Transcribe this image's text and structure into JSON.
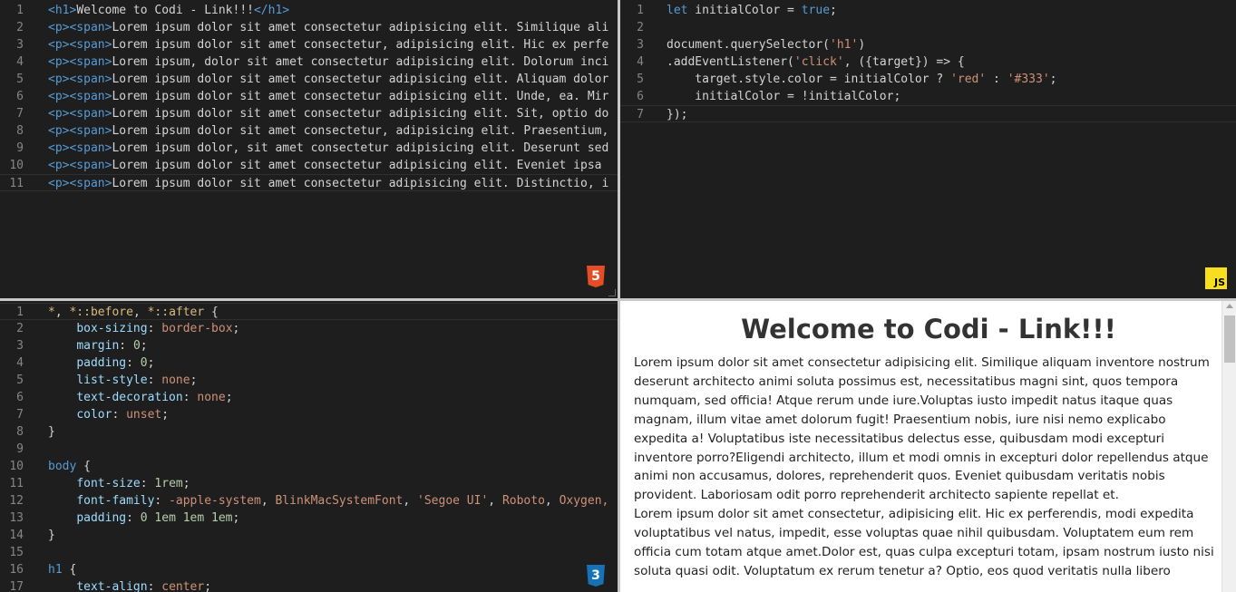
{
  "html_editor": {
    "badge": "5",
    "lines": [
      {
        "n": "1",
        "parts": [
          [
            "tag",
            "<h1>"
          ],
          [
            "",
            "Welcome to Codi - Link!!!"
          ],
          [
            "tag",
            "</h1>"
          ]
        ]
      },
      {
        "n": "2",
        "parts": [
          [
            "tag",
            "<p><span>"
          ],
          [
            "",
            "Lorem ipsum dolor sit amet consectetur adipisicing elit. Similique ali"
          ]
        ]
      },
      {
        "n": "3",
        "parts": [
          [
            "tag",
            "<p><span>"
          ],
          [
            "",
            "Lorem ipsum dolor sit amet consectetur, adipisicing elit. Hic ex perfe"
          ]
        ]
      },
      {
        "n": "4",
        "parts": [
          [
            "tag",
            "<p><span>"
          ],
          [
            "",
            "Lorem ipsum, dolor sit amet consectetur adipisicing elit. Dolorum inci"
          ]
        ]
      },
      {
        "n": "5",
        "parts": [
          [
            "tag",
            "<p><span>"
          ],
          [
            "",
            "Lorem ipsum dolor sit amet consectetur adipisicing elit. Aliquam dolor"
          ]
        ]
      },
      {
        "n": "6",
        "parts": [
          [
            "tag",
            "<p><span>"
          ],
          [
            "",
            "Lorem ipsum dolor sit amet consectetur adipisicing elit. Unde, ea. Mir"
          ]
        ]
      },
      {
        "n": "7",
        "parts": [
          [
            "tag",
            "<p><span>"
          ],
          [
            "",
            "Lorem ipsum dolor sit amet consectetur adipisicing elit. Sit, optio do"
          ]
        ]
      },
      {
        "n": "8",
        "parts": [
          [
            "tag",
            "<p><span>"
          ],
          [
            "",
            "Lorem ipsum dolor sit amet consectetur, adipisicing elit. Praesentium,"
          ]
        ]
      },
      {
        "n": "9",
        "parts": [
          [
            "tag",
            "<p><span>"
          ],
          [
            "",
            "Lorem ipsum dolor, sit amet consectetur adipisicing elit. Deserunt sed"
          ]
        ]
      },
      {
        "n": "10",
        "parts": [
          [
            "tag",
            "<p><span>"
          ],
          [
            "",
            "Lorem ipsum dolor sit amet consectetur adipisicing elit. Eveniet ipsa"
          ]
        ]
      },
      {
        "n": "11",
        "parts": [
          [
            "tag",
            "<p><span>"
          ],
          [
            "",
            "Lorem ipsum dolor sit amet consectetur adipisicing elit. Distinctio, i"
          ]
        ]
      }
    ]
  },
  "js_editor": {
    "badge": "JS",
    "lines": [
      {
        "n": "1",
        "parts": [
          [
            "kw",
            "let"
          ],
          [
            "",
            " initialColor = "
          ],
          [
            "kw",
            "true"
          ],
          [
            "",
            ";"
          ]
        ]
      },
      {
        "n": "2",
        "parts": []
      },
      {
        "n": "3",
        "parts": [
          [
            "",
            "document.querySelector("
          ],
          [
            "str",
            "'h1'"
          ],
          [
            "",
            ")"
          ]
        ]
      },
      {
        "n": "4",
        "parts": [
          [
            "",
            ".addEventListener("
          ],
          [
            "str",
            "'click'"
          ],
          [
            "",
            ", ({target}) => {"
          ]
        ]
      },
      {
        "n": "5",
        "parts": [
          [
            "",
            "    target.style.color = initialColor ? "
          ],
          [
            "str",
            "'red'"
          ],
          [
            "",
            " : "
          ],
          [
            "str",
            "'#333'"
          ],
          [
            "",
            ";"
          ]
        ]
      },
      {
        "n": "6",
        "parts": [
          [
            "",
            "    initialColor = !initialColor;"
          ]
        ]
      },
      {
        "n": "7",
        "parts": [
          [
            "",
            "});"
          ]
        ]
      }
    ]
  },
  "css_editor": {
    "badge": "3",
    "lines": [
      {
        "n": "1",
        "parts": [
          [
            "sel",
            "*"
          ],
          [
            "",
            ", "
          ],
          [
            "sel",
            "*::before"
          ],
          [
            "",
            ", "
          ],
          [
            "sel",
            "*::after"
          ],
          [
            "",
            " {"
          ]
        ]
      },
      {
        "n": "2",
        "parts": [
          [
            "",
            "    "
          ],
          [
            "prop",
            "box-sizing"
          ],
          [
            "",
            ": "
          ],
          [
            "str",
            "border-box"
          ],
          [
            "",
            ";"
          ]
        ]
      },
      {
        "n": "3",
        "parts": [
          [
            "",
            "    "
          ],
          [
            "prop",
            "margin"
          ],
          [
            "",
            ": "
          ],
          [
            "num",
            "0"
          ],
          [
            "",
            ";"
          ]
        ]
      },
      {
        "n": "4",
        "parts": [
          [
            "",
            "    "
          ],
          [
            "prop",
            "padding"
          ],
          [
            "",
            ": "
          ],
          [
            "num",
            "0"
          ],
          [
            "",
            ";"
          ]
        ]
      },
      {
        "n": "5",
        "parts": [
          [
            "",
            "    "
          ],
          [
            "prop",
            "list-style"
          ],
          [
            "",
            ": "
          ],
          [
            "str",
            "none"
          ],
          [
            "",
            ";"
          ]
        ]
      },
      {
        "n": "6",
        "parts": [
          [
            "",
            "    "
          ],
          [
            "prop",
            "text-decoration"
          ],
          [
            "",
            ": "
          ],
          [
            "str",
            "none"
          ],
          [
            "",
            ";"
          ]
        ]
      },
      {
        "n": "7",
        "parts": [
          [
            "",
            "    "
          ],
          [
            "prop",
            "color"
          ],
          [
            "",
            ": "
          ],
          [
            "str",
            "unset"
          ],
          [
            "",
            ";"
          ]
        ]
      },
      {
        "n": "8",
        "parts": [
          [
            "",
            "}"
          ]
        ]
      },
      {
        "n": "9",
        "parts": []
      },
      {
        "n": "10",
        "parts": [
          [
            "tag",
            "body"
          ],
          [
            "",
            " {"
          ]
        ]
      },
      {
        "n": "11",
        "parts": [
          [
            "",
            "    "
          ],
          [
            "prop",
            "font-size"
          ],
          [
            "",
            ": "
          ],
          [
            "num",
            "1rem"
          ],
          [
            "",
            ";"
          ]
        ]
      },
      {
        "n": "12",
        "parts": [
          [
            "",
            "    "
          ],
          [
            "prop",
            "font-family"
          ],
          [
            "",
            ": "
          ],
          [
            "str",
            "-apple-system"
          ],
          [
            "",
            ", "
          ],
          [
            "str",
            "BlinkMacSystemFont"
          ],
          [
            "",
            ", "
          ],
          [
            "str",
            "'Segoe UI'"
          ],
          [
            "",
            ", "
          ],
          [
            "str",
            "Roboto"
          ],
          [
            "",
            ", "
          ],
          [
            "str",
            "Oxygen,"
          ]
        ]
      },
      {
        "n": "13",
        "parts": [
          [
            "",
            "    "
          ],
          [
            "prop",
            "padding"
          ],
          [
            "",
            ": "
          ],
          [
            "num",
            "0 1em 1em 1em"
          ],
          [
            "",
            ";"
          ]
        ]
      },
      {
        "n": "14",
        "parts": [
          [
            "",
            "}"
          ]
        ]
      },
      {
        "n": "15",
        "parts": []
      },
      {
        "n": "16",
        "parts": [
          [
            "tag",
            "h1"
          ],
          [
            "",
            " {"
          ]
        ]
      },
      {
        "n": "17",
        "parts": [
          [
            "",
            "    "
          ],
          [
            "prop",
            "text-align"
          ],
          [
            "",
            ": "
          ],
          [
            "str",
            "center"
          ],
          [
            "",
            ";"
          ]
        ]
      }
    ]
  },
  "output": {
    "heading": "Welcome to Codi - Link!!!",
    "paragraphs": [
      "Lorem ipsum dolor sit amet consectetur adipisicing elit. Similique aliquam inventore nostrum deserunt architecto animi soluta possimus est, necessitatibus magni sint, quos tempora numquam, sed officia! Atque rerum unde iure.Voluptas iusto impedit natus itaque quas magnam, illum vitae amet dolorum fugit! Praesentium nobis, iure nisi nemo explicabo expedita a! Voluptatibus iste necessitatibus delectus esse, quibusdam modi excepturi inventore porro?Eligendi architecto, illum et modi omnis in excepturi dolor repellendus atque animi non accusamus, dolores, reprehenderit quos. Eveniet quibusdam veritatis nobis provident. Laboriosam odit porro reprehenderit architecto sapiente repellat et.",
      "Lorem ipsum dolor sit amet consectetur, adipisicing elit. Hic ex perferendis, modi expedita voluptatibus vel natus, impedit, esse voluptas quae nihil quibusdam. Voluptatem eum rem officia cum totam atque amet.Dolor est, quas culpa excepturi totam, ipsam nostrum iusto nisi soluta quasi odit. Voluptatum ex rerum tenetur a? Optio, eos quod veritatis nulla libero"
    ]
  },
  "colors": {
    "editor_bg": "#1e1e1e",
    "line_number": "#858585",
    "tag": "#569cd6",
    "string": "#ce9178",
    "number": "#b5cea8",
    "property": "#9cdcfe",
    "selector": "#d7ba7d",
    "html_badge": "#e44d26",
    "css_badge": "#1572b6",
    "js_badge": "#f7df1e"
  }
}
